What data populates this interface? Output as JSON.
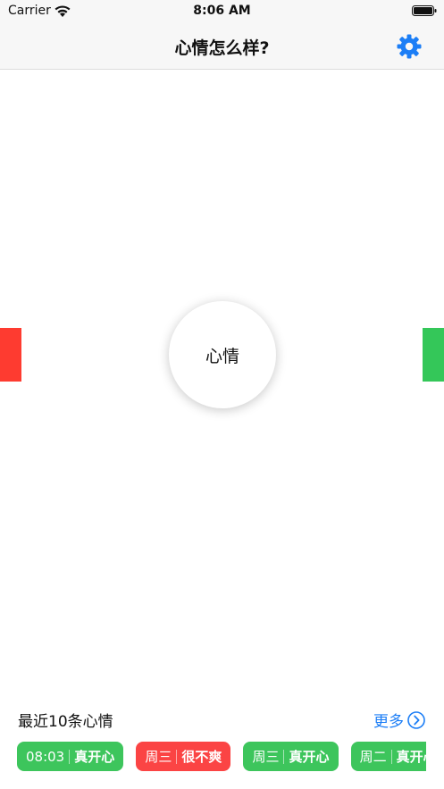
{
  "status_bar": {
    "carrier": "Carrier",
    "time": "8:06 AM"
  },
  "nav": {
    "title": "心情怎么样?",
    "settings_icon": "gear-icon"
  },
  "main": {
    "circle_label": "心情",
    "left_bar_color": "#fe3b30",
    "right_bar_color": "#34c759"
  },
  "recent": {
    "title": "最近10条心情",
    "more_label": "更多",
    "items": [
      {
        "time": "08:03",
        "mood": "真开心",
        "color": "green"
      },
      {
        "time": "周三",
        "mood": "很不爽",
        "color": "red"
      },
      {
        "time": "周三",
        "mood": "真开心",
        "color": "green"
      },
      {
        "time": "周二",
        "mood": "真开心",
        "color": "green"
      }
    ]
  },
  "colors": {
    "accent": "#1c7ef6",
    "happy": "#3dc55c",
    "unhappy": "#fb4444"
  }
}
